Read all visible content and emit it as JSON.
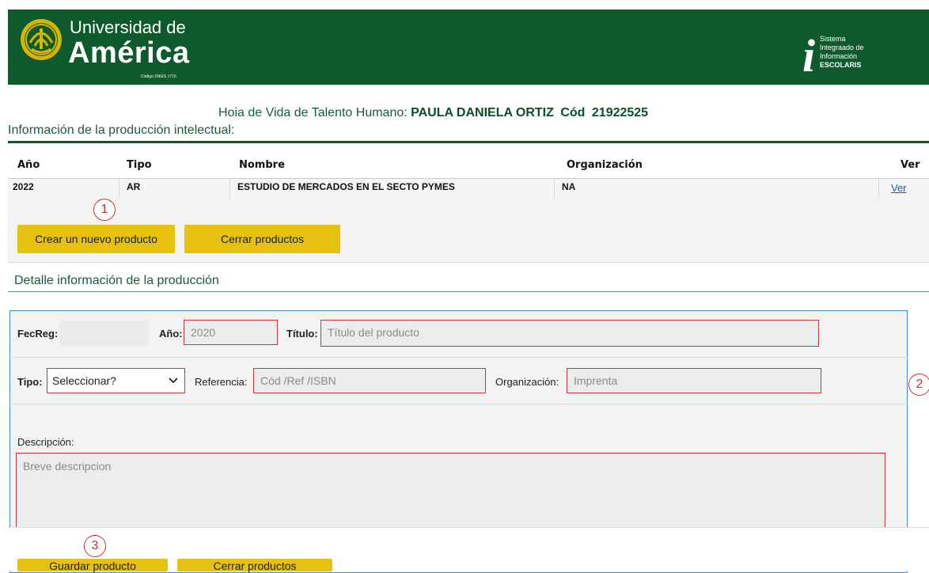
{
  "header": {
    "brand_line1": "Universidad de",
    "brand_line2": "América",
    "brand_code": "Código SNIES 1715",
    "system_line1": "Sistema",
    "system_line2": "Integraado de",
    "system_line3": "Información",
    "system_line4": "ESCOLARIS",
    "system_icon_letter": "i",
    "bg_color": "#0f5a2c"
  },
  "page": {
    "title_prefix": "Hoia de Vida de Talento Humano:",
    "person_name": "PAULA DANIELA ORTIZ",
    "code_label": "Cód",
    "code_value": "21922525",
    "section_title": "Información de la producción intelectual:"
  },
  "table": {
    "headers": [
      "Año",
      "Tipo",
      "Nombre",
      "Organización",
      "Ver"
    ],
    "rows": [
      {
        "year": "2022",
        "type": "AR",
        "name": "ESTUDIO DE MERCADOS EN EL SECTO PYMES",
        "organization": "NA",
        "link": "Ver"
      }
    ]
  },
  "markers": [
    "1",
    "2",
    "3"
  ],
  "actions_top": {
    "create_label": "Crear un nuevo producto",
    "close_label": "Cerrar productos"
  },
  "detail": {
    "title": "Detalle información de la producción",
    "fecreg_label": "FecReg:",
    "fecreg_value": "",
    "year_label": "Año:",
    "year_placeholder": "2020",
    "title_label": "Título:",
    "title_placeholder": "Título del producto",
    "type_label": "Tipo:",
    "type_selected": "Seleccionar?",
    "reference_label": "Referencia:",
    "reference_placeholder": "Cód /Ref /ISBN",
    "organization_label": "Organización:",
    "organization_placeholder": "Imprenta",
    "description_label": "Descripción:",
    "description_placeholder": "Breve descripcion"
  },
  "actions_bottom": {
    "save_label": "Guardar producto",
    "close_label": "Cerrar productos"
  },
  "colors": {
    "accent_yellow": "#e6c10f",
    "brand_green": "#0f5a2c",
    "error_red": "#c9363a",
    "focus_blue": "#3a8ad2"
  }
}
